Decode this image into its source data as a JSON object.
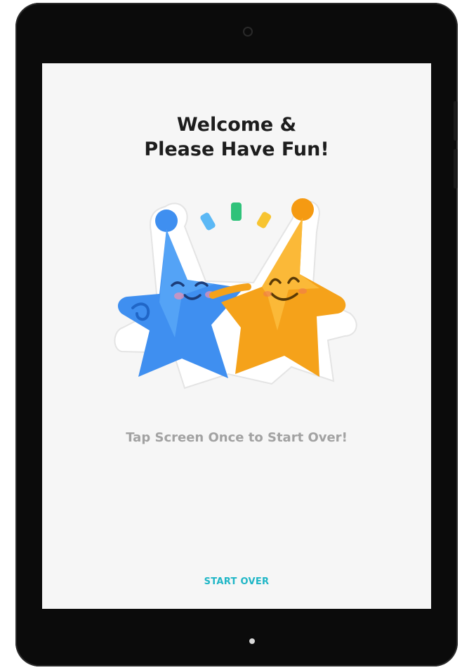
{
  "screen": {
    "title_line1": "Welcome &",
    "title_line2": "Please Have Fun!",
    "tap_instruction": "Tap Screen Once to Start Over!",
    "start_over_label": "START OVER"
  },
  "illustration": {
    "icon": "two-star-mascots-icon",
    "colors": {
      "blue_star": "#3f8ff0",
      "orange_star": "#f5a21a",
      "spark_blue": "#5bb8f5",
      "spark_green": "#2fc27a",
      "spark_yellow": "#f7c431"
    }
  },
  "colors": {
    "accent": "#1fb6c6",
    "title": "#1d1d1d",
    "subtle_text": "#a2a2a2",
    "screen_bg": "#f6f6f6",
    "device_frame": "#0b0b0b"
  }
}
